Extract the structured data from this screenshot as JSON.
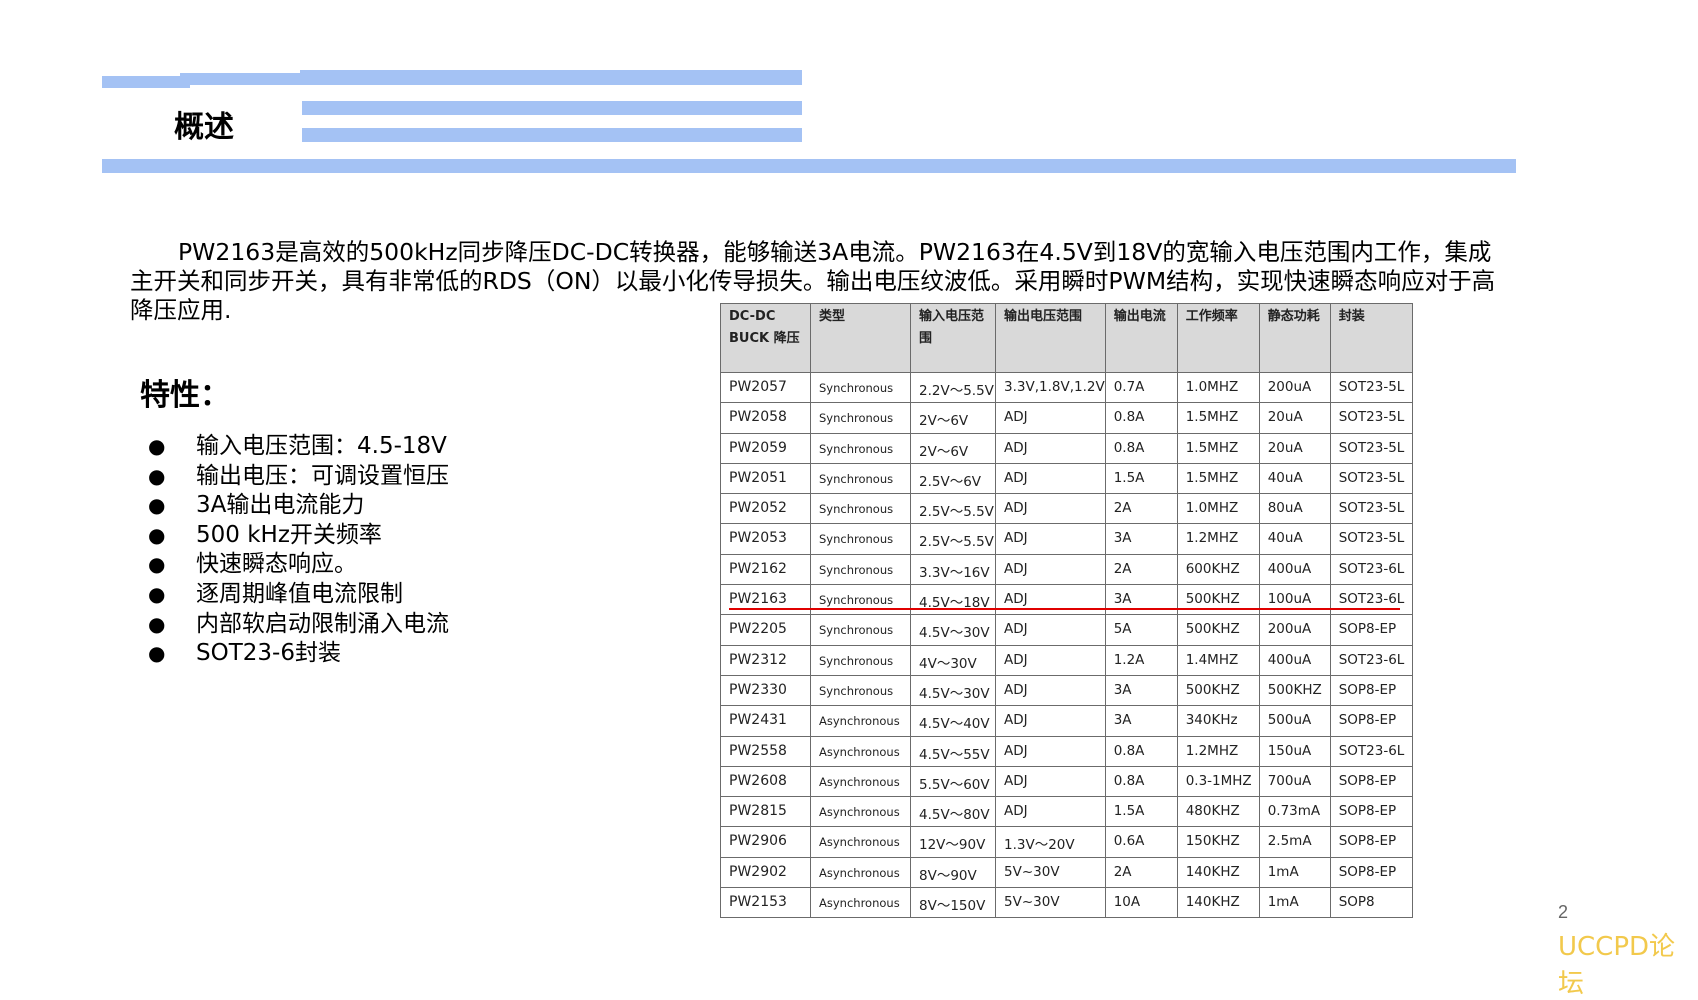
{
  "title": "概述",
  "intro": "PW2163是高效的500kHz同步降压DC-DC转换器，能够输送3A电流。PW2163在4.5V到18V的宽输入电压范围内工作，集成主开关和同步开关，具有非常低的RDS（ON）以最小化传导损失。输出电压纹波低。采用瞬时PWM结构，实现快速瞬态响应对于高降压应用.",
  "features_title": "特性：",
  "bullet_glyph": "●",
  "features": [
    "输入电压范围：4.5-18V",
    "输出电压：可调设置恒压",
    "3A输出电流能力",
    "500 kHz开关频率",
    "快速瞬态响应。",
    "逐周期峰值电流限制",
    "内部软启动限制涌入电流",
    "SOT23-6封装"
  ],
  "table": {
    "headers": [
      "DC-DC BUCK 降压",
      "类型",
      "输入电压范围",
      "输出电压范围",
      "输出电流",
      "工作频率",
      "静态功耗",
      "封装"
    ],
    "rows": [
      [
        "PW2057",
        "Synchronous",
        "2.2V～5.5V",
        "3.3V,1.8V,1.2V",
        "0.7A",
        "1.0MHZ",
        "200uA",
        "SOT23-5L"
      ],
      [
        "PW2058",
        "Synchronous",
        "2V～6V",
        "ADJ",
        "0.8A",
        "1.5MHZ",
        "20uA",
        "SOT23-5L"
      ],
      [
        "PW2059",
        "Synchronous",
        "2V～6V",
        "ADJ",
        "0.8A",
        "1.5MHZ",
        "20uA",
        "SOT23-5L"
      ],
      [
        "PW2051",
        "Synchronous",
        "2.5V～6V",
        "ADJ",
        "1.5A",
        "1.5MHZ",
        "40uA",
        "SOT23-5L"
      ],
      [
        "PW2052",
        "Synchronous",
        "2.5V～5.5V",
        "ADJ",
        "2A",
        "1.0MHZ",
        "80uA",
        "SOT23-5L"
      ],
      [
        "PW2053",
        "Synchronous",
        "2.5V～5.5V",
        "ADJ",
        "3A",
        "1.2MHZ",
        "40uA",
        "SOT23-5L"
      ],
      [
        "PW2162",
        "Synchronous",
        "3.3V～16V",
        "ADJ",
        "2A",
        "600KHZ",
        "400uA",
        "SOT23-6L"
      ],
      [
        "PW2163",
        "Synchronous",
        "4.5V～18V",
        "ADJ",
        "3A",
        "500KHZ",
        "100uA",
        "SOT23-6L"
      ],
      [
        "PW2205",
        "Synchronous",
        "4.5V～30V",
        "ADJ",
        "5A",
        "500KHZ",
        "200uA",
        "SOP8-EP"
      ],
      [
        "PW2312",
        "Synchronous",
        "4V～30V",
        "ADJ",
        "1.2A",
        "1.4MHZ",
        "400uA",
        "SOT23-6L"
      ],
      [
        "PW2330",
        "Synchronous",
        "4.5V～30V",
        "ADJ",
        "3A",
        "500KHZ",
        "500KHZ",
        "SOP8-EP"
      ],
      [
        "PW2431",
        "Asynchronous",
        "4.5V～40V",
        "ADJ",
        "3A",
        "340KHz",
        "500uA",
        "SOP8-EP"
      ],
      [
        "PW2558",
        "Asynchronous",
        "4.5V～55V",
        "ADJ",
        "0.8A",
        "1.2MHZ",
        "150uA",
        "SOT23-6L"
      ],
      [
        "PW2608",
        "Asynchronous",
        "5.5V～60V",
        "ADJ",
        "0.8A",
        "0.3-1MHZ",
        "700uA",
        "SOP8-EP"
      ],
      [
        "PW2815",
        "Asynchronous",
        "4.5V～80V",
        "ADJ",
        "1.5A",
        "480KHZ",
        "0.73mA",
        "SOP8-EP"
      ],
      [
        "PW2906",
        "Asynchronous",
        "12V～90V",
        "1.3V～20V",
        "0.6A",
        "150KHZ",
        "2.5mA",
        "SOP8-EP"
      ],
      [
        "PW2902",
        "Asynchronous",
        "8V～90V",
        "5V~30V",
        "2A",
        "140KHZ",
        "1mA",
        "SOP8-EP"
      ],
      [
        "PW2153",
        "Asynchronous",
        "8V～150V",
        "5V~30V",
        "10A",
        "140KHZ",
        "1mA",
        "SOP8"
      ]
    ],
    "highlighted_row": "PW2163",
    "highlight_color": "#e00000"
  },
  "page_number": "2",
  "watermark": "UCCPD论坛",
  "colors": {
    "accent_bar": "#a4c2f4",
    "header_bg": "#d9d9d9",
    "watermark": "#f2c94c"
  }
}
